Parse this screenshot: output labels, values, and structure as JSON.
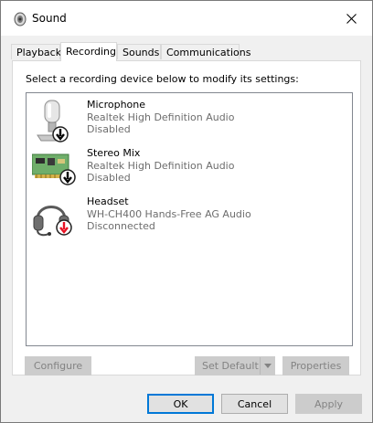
{
  "window": {
    "title": "Sound",
    "close_icon": "close-icon",
    "app_icon": "speaker-icon"
  },
  "tabs": [
    {
      "label": "Playback",
      "active": false
    },
    {
      "label": "Recording",
      "active": true
    },
    {
      "label": "Sounds",
      "active": false
    },
    {
      "label": "Communications",
      "active": false
    }
  ],
  "instruction": "Select a recording device below to modify its settings:",
  "devices": [
    {
      "name": "Microphone",
      "description": "Realtek High Definition Audio",
      "status": "Disabled",
      "icon": "microphone-icon",
      "badge": "down-arrow-black"
    },
    {
      "name": "Stereo Mix",
      "description": "Realtek High Definition Audio",
      "status": "Disabled",
      "icon": "sound-card-icon",
      "badge": "down-arrow-black"
    },
    {
      "name": "Headset",
      "description": "WH-CH400 Hands-Free AG Audio",
      "status": "Disconnected",
      "icon": "headset-icon",
      "badge": "down-arrow-red"
    }
  ],
  "panel_buttons": {
    "configure": "Configure",
    "set_default": "Set Default",
    "properties": "Properties"
  },
  "dialog_buttons": {
    "ok": "OK",
    "cancel": "Cancel",
    "apply": "Apply"
  },
  "colors": {
    "accent": "#0078d7",
    "disabled_text": "#838383",
    "badge_red": "#e81123"
  }
}
